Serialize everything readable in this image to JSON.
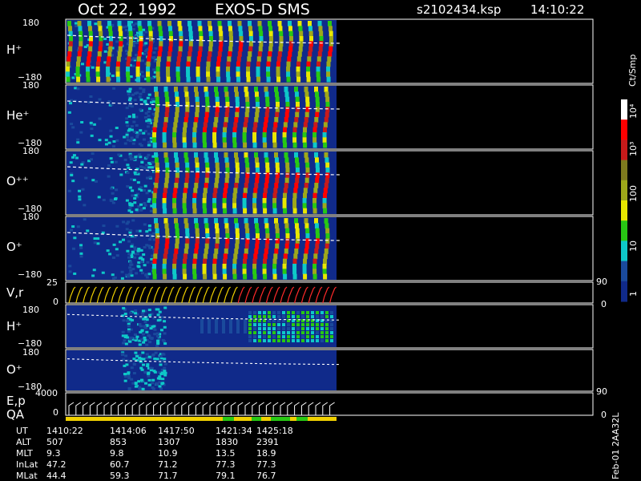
{
  "header": {
    "date": "Oct 22, 1992",
    "instrument": "EXOS-D SMS",
    "file": "s2102434.ksp",
    "time": "14:10:22"
  },
  "colorbar": {
    "unit": "Ct/Smp",
    "ticks": [
      "10⁴",
      "10³",
      "100",
      "10",
      "1"
    ],
    "colors": [
      "#ffffff",
      "#ff0000",
      "#c81a1a",
      "#7e7a1e",
      "#9ea81a",
      "#e8e800",
      "#28c814",
      "#0ec8c8",
      "#1a4a9c",
      "#102a8a"
    ]
  },
  "panels": {
    "ion_labels": [
      "H⁺",
      "He⁺",
      "O⁺⁺",
      "O⁺"
    ],
    "angle_top": "180",
    "angle_bottom": "−180",
    "vr": {
      "label": "V,r",
      "top": "25",
      "bottom": "0",
      "right_top": "90",
      "right_bottom": "0"
    },
    "lower": [
      {
        "label": "H⁺",
        "top": "180",
        "bottom": "−180"
      },
      {
        "label": "O⁺",
        "top": "180",
        "bottom": "−180"
      }
    ],
    "ep": {
      "label": "E,p",
      "label2": "QA",
      "top": "4000",
      "bottom": "0",
      "right_top": "90",
      "right_bottom": "0"
    }
  },
  "chart_data": {
    "type": "heatmap",
    "x_unit": "UT",
    "x_ticks": [
      "1410:22",
      "1414:06",
      "1417:50",
      "1421:34",
      "1425:18"
    ],
    "panels": [
      "H⁺",
      "He⁺",
      "O⁺⁺",
      "O⁺",
      "V,r",
      "H⁺",
      "O⁺",
      "E,p"
    ],
    "y_range": [
      -180,
      180
    ],
    "color_scale": "log",
    "color_range": [
      1,
      10000
    ],
    "data_end": "1425:18",
    "ephemeris": [
      {
        "name": "UT",
        "values": [
          "1410:22",
          "1414:06",
          "1417:50",
          "1421:34",
          "1425:18"
        ]
      },
      {
        "name": "ALT",
        "values": [
          "507",
          "853",
          "1307",
          "1830",
          "2391"
        ]
      },
      {
        "name": "MLT",
        "values": [
          "9.3",
          "9.8",
          "10.9",
          "13.5",
          "18.9"
        ]
      },
      {
        "name": "InLat",
        "values": [
          "47.2",
          "60.7",
          "71.2",
          "77.3",
          "77.3"
        ]
      },
      {
        "name": "MLat",
        "values": [
          "44.4",
          "59.3",
          "71.7",
          "79.1",
          "76.7"
        ]
      }
    ]
  },
  "footer": {
    "side_label": "Feb-01 2AA32L"
  }
}
